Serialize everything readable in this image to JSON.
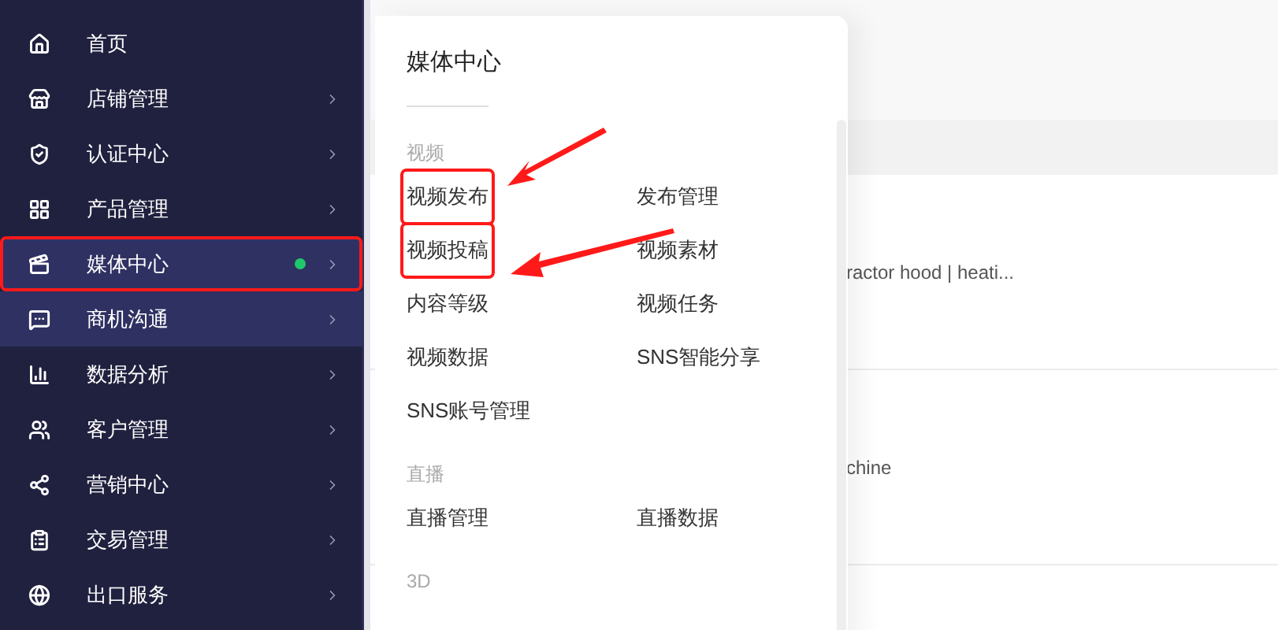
{
  "sidebar": {
    "items": [
      {
        "label": "首页",
        "highlighted": false,
        "has_submenu": false,
        "dot": false,
        "annotated": false
      },
      {
        "label": "店铺管理",
        "highlighted": false,
        "has_submenu": true,
        "dot": false,
        "annotated": false
      },
      {
        "label": "认证中心",
        "highlighted": false,
        "has_submenu": true,
        "dot": false,
        "annotated": false
      },
      {
        "label": "产品管理",
        "highlighted": false,
        "has_submenu": true,
        "dot": false,
        "annotated": false
      },
      {
        "label": "媒体中心",
        "highlighted": true,
        "has_submenu": true,
        "dot": true,
        "annotated": true
      },
      {
        "label": "商机沟通",
        "highlighted": true,
        "has_submenu": true,
        "dot": false,
        "annotated": false
      },
      {
        "label": "数据分析",
        "highlighted": false,
        "has_submenu": true,
        "dot": false,
        "annotated": false
      },
      {
        "label": "客户管理",
        "highlighted": false,
        "has_submenu": true,
        "dot": false,
        "annotated": false
      },
      {
        "label": "营销中心",
        "highlighted": false,
        "has_submenu": true,
        "dot": false,
        "annotated": false
      },
      {
        "label": "交易管理",
        "highlighted": false,
        "has_submenu": true,
        "dot": false,
        "annotated": false
      },
      {
        "label": "出口服务",
        "highlighted": false,
        "has_submenu": true,
        "dot": false,
        "annotated": false
      }
    ]
  },
  "flyout": {
    "title": "媒体中心",
    "sections": [
      {
        "heading": "视频",
        "links": [
          {
            "label": "视频发布",
            "annotated": true
          },
          {
            "label": "发布管理",
            "annotated": false
          },
          {
            "label": "视频投稿",
            "annotated": true
          },
          {
            "label": "视频素材",
            "annotated": false
          },
          {
            "label": "内容等级",
            "annotated": false
          },
          {
            "label": "视频任务",
            "annotated": false
          },
          {
            "label": "视频数据",
            "annotated": false
          },
          {
            "label": "SNS智能分享",
            "annotated": false
          },
          {
            "label": "SNS账号管理",
            "annotated": false
          }
        ]
      },
      {
        "heading": "直播",
        "links": [
          {
            "label": "直播管理",
            "annotated": false
          },
          {
            "label": "直播数据",
            "annotated": false
          }
        ]
      },
      {
        "heading": "3D"
      }
    ]
  },
  "table": {
    "rows": [
      {
        "column_1": "ractor hood | heati..."
      },
      {
        "column_1": "chine"
      }
    ]
  }
}
